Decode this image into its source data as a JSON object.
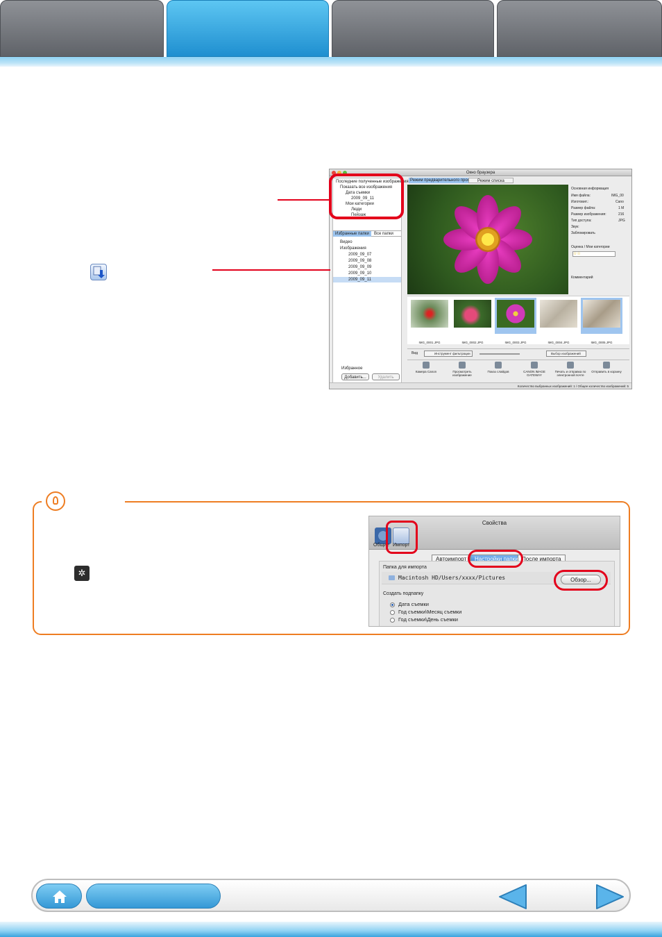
{
  "browser_window": {
    "title": "Окно браузера",
    "view_tabs": [
      "Режим предварительного просмотра",
      "Режим списка"
    ],
    "sidebar_header": "Последние полученные изображения",
    "tree_top": [
      "Показать все изображения",
      "Дата съемки",
      "2009_09_11",
      "Мои категории",
      "Люди",
      "Пейзаж"
    ],
    "folder_tabs": [
      "Избранные папки",
      "Все папки"
    ],
    "folders": [
      "Видео",
      "Изображения",
      "2009_09_07",
      "2009_09_08",
      "2009_09_09",
      "2009_09_10",
      "2009_09_11"
    ],
    "favorites_label": "Избранное",
    "add_button": "Добавить...",
    "remove_button": "Удалить",
    "info_section": "Основная информация",
    "info_rows": [
      "Имя файла:",
      "Изготовит.:",
      "Размер файла:",
      "Размер изображения:",
      "Тип доступа:",
      "Звук:",
      "Заблокировать"
    ],
    "info_values": [
      "IMG_00",
      "Cano",
      "1 M",
      "216",
      "JPG"
    ],
    "rating_section": "Оценка / Мои категории",
    "comment_section": "Комментарий",
    "thumbnails": [
      "IMG_0001.JPG",
      "IMG_0002.JPG",
      "IMG_0003.JPG",
      "IMG_0004.JPG",
      "IMG_0005.JPG"
    ],
    "toolbar_view": "Вид",
    "filter_tool": "Инструмент фильтрации",
    "select_images": "Выбор изображений",
    "actions": [
      "Камера Canon",
      "Просмотреть изображение",
      "Показ слайдов",
      "CANON iMAGE GATEWAY",
      "Печать и отправка по электронной почте",
      "Отправить в корзину"
    ],
    "status": "Количество выбранных изображений: 1 / Общее количество изображений: 5"
  },
  "prefs_window": {
    "title": "Свойства",
    "icons": [
      "Общие",
      "Импорт"
    ],
    "tabs": [
      "Автоимпорт",
      "Настройки папки",
      "После импорта"
    ],
    "folder_label": "Папка для импорта",
    "folder_path": "Macintosh HD/Users/xxxx/Pictures",
    "browse_button": "Обзор...",
    "subfolder_label": "Создать подпапку",
    "subfolder_options": [
      "Дата съемки",
      "Год съемки\\Месяц съемки",
      "Год съемки\\День съемки"
    ]
  },
  "colors": {
    "accent_blue": "#2d9ad8",
    "highlight_red": "#e3001b",
    "hint_orange": "#ee7d22"
  },
  "icons": [
    "home-icon",
    "prev-arrow-icon",
    "next-arrow-icon",
    "lightbulb-icon",
    "gear-icon",
    "import-icon"
  ]
}
